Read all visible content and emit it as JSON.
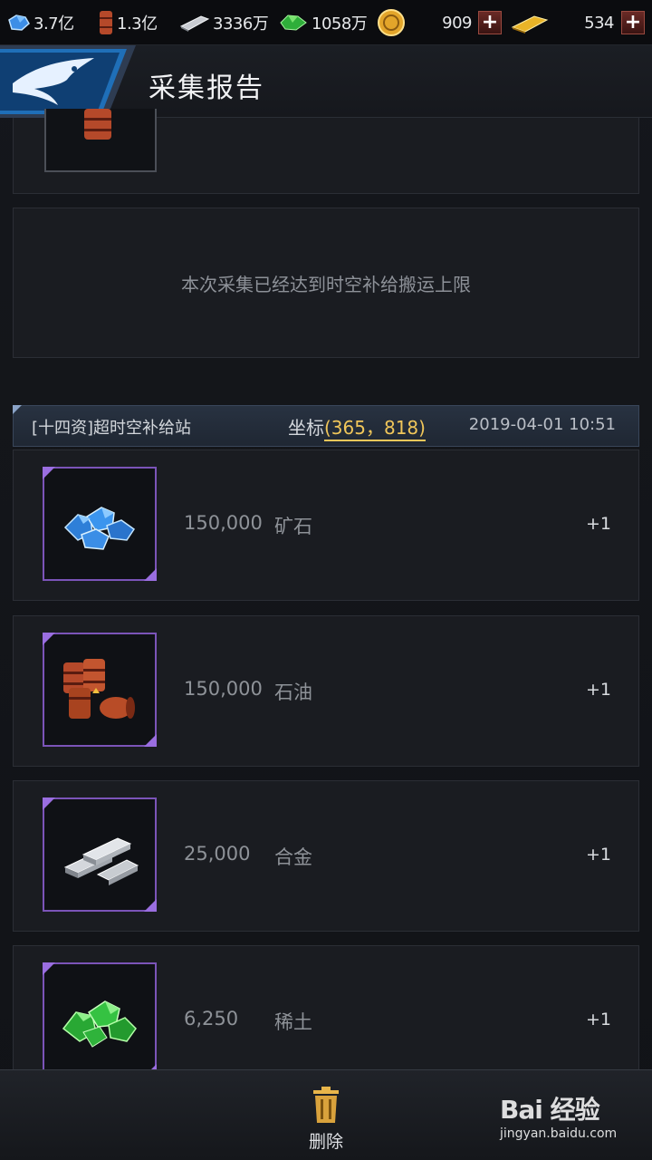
{
  "resources": [
    {
      "icon": "ore-icon",
      "value": "3.7亿"
    },
    {
      "icon": "oil-icon",
      "value": "1.3亿"
    },
    {
      "icon": "alloy-icon",
      "value": "3336万"
    },
    {
      "icon": "rare-earth-icon",
      "value": "1058万"
    },
    {
      "icon": "coin-icon",
      "value": "909"
    },
    {
      "icon": "gold-bar-icon",
      "value": "534"
    }
  ],
  "header": {
    "title": "采集报告"
  },
  "notice": {
    "text": "本次采集已经达到时空补给搬运上限"
  },
  "report": {
    "source": "[十四资]超时空补给站",
    "coord_label": "坐标",
    "coord_value": "(365，818)",
    "time": "2019-04-01 10:51",
    "items": [
      {
        "icon": "ore-icon",
        "amount": "150,000",
        "name": "矿石",
        "count": "+1"
      },
      {
        "icon": "oil-barrels-icon",
        "amount": "150,000",
        "name": "石油",
        "count": "+1"
      },
      {
        "icon": "alloy-ingots-icon",
        "amount": "25,000",
        "name": "合金",
        "count": "+1"
      },
      {
        "icon": "rare-earth-crystals-icon",
        "amount": "6,250",
        "name": "稀土",
        "count": "+1"
      }
    ]
  },
  "footer": {
    "delete_label": "删除"
  },
  "watermark": {
    "brand": "Bai 经验",
    "url": "jingyan.baidu.com"
  },
  "colors": {
    "accent": "#f0c65a",
    "frame_purple": "#7b54b8",
    "header_bg": "#283241"
  }
}
